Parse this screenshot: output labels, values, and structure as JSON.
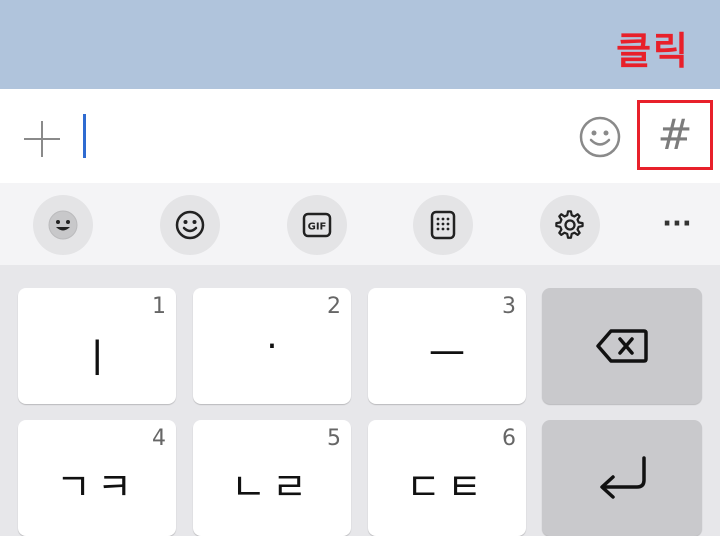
{
  "annotation": {
    "text": "클릭",
    "color": "#e8202a"
  },
  "colors": {
    "topbar": "#b0c4dc",
    "caret": "#2f6bd1",
    "highlight": "#e8202a"
  },
  "input": {
    "value": "",
    "hash_symbol": "#"
  },
  "toolbar": {
    "items": [
      "emoji-face-icon",
      "smiley-icon",
      "gif-icon",
      "keypad-icon",
      "gear-icon",
      "more-icon"
    ],
    "gif_label": "GIF",
    "more_label": "···"
  },
  "keys": [
    {
      "num": "1",
      "label": "ㅣ"
    },
    {
      "num": "2",
      "label": "·"
    },
    {
      "num": "3",
      "label": "ㅡ"
    },
    {
      "num": "4",
      "label": "ㄱㅋ"
    },
    {
      "num": "5",
      "label": "ㄴㄹ"
    },
    {
      "num": "6",
      "label": "ㄷㅌ"
    }
  ]
}
